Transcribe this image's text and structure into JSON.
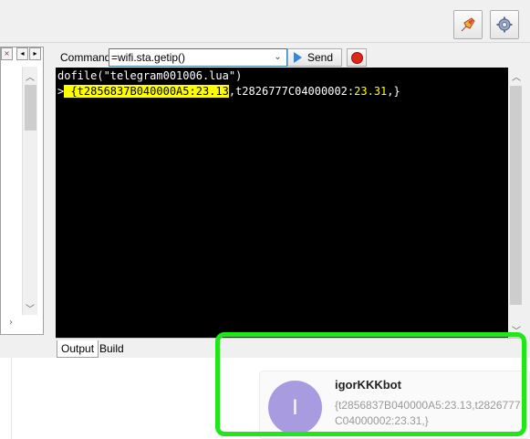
{
  "toolbar": {
    "icons": [
      "rocket-icon",
      "settings-gear-icon"
    ]
  },
  "command_bar": {
    "label": "Command",
    "value": "=wifi.sta.getip()",
    "send_label": "Send"
  },
  "console": {
    "line1": "dofile(\"telegram001006.lua\")",
    "prompt": ">",
    "hl_open": " {t2856837B040000A5:",
    "hl_value": "23.13",
    "rest_key": ",t2826777C04000002:",
    "rest_value": "23.31",
    "rest_close": ",}"
  },
  "tabs": [
    {
      "label": "Output",
      "active": true
    },
    {
      "label": "Build",
      "active": false
    }
  ],
  "chat": {
    "avatar_letter": "I",
    "sender": "igorKKKbot",
    "text": "{t2856837B040000A5:23.13,t2826777C04000002:23.31,}"
  },
  "colors": {
    "highlight_frame": "#21e61a",
    "console_bg": "#000000",
    "console_highlight": "#ffff00",
    "avatar_bg": "#a99be0"
  }
}
